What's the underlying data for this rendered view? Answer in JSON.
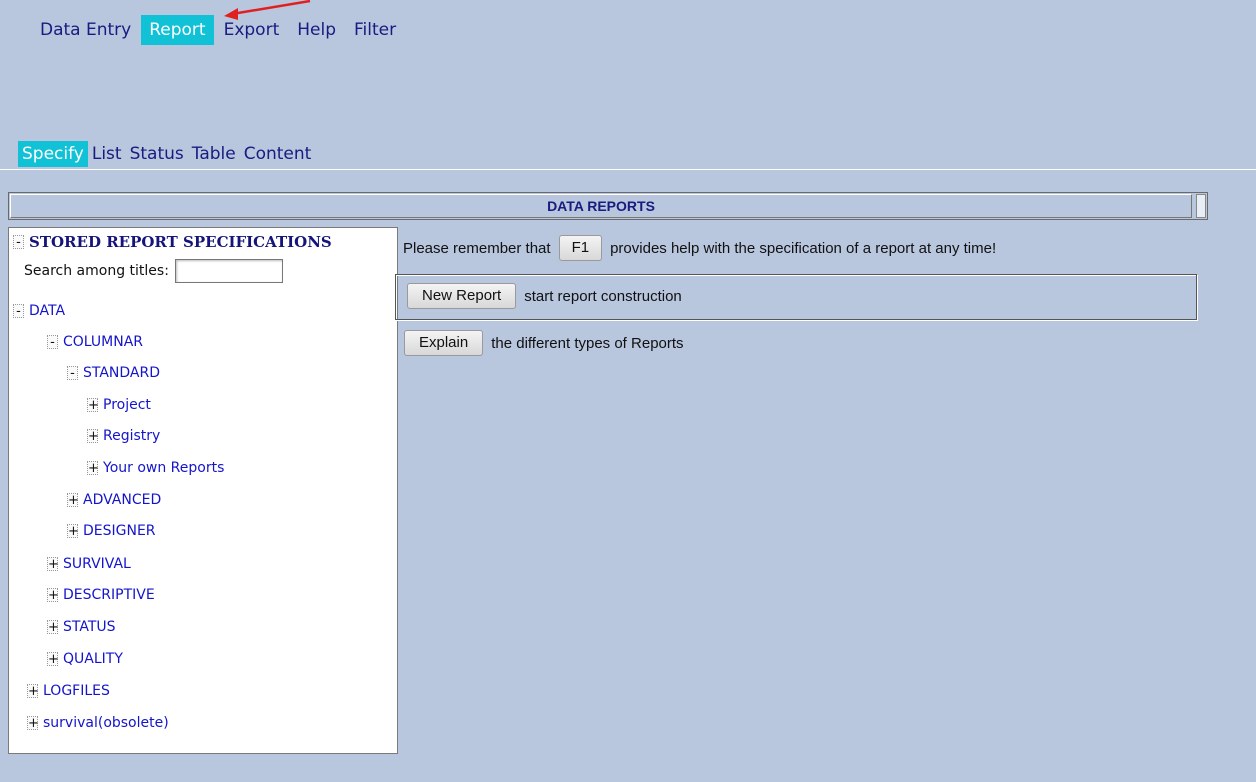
{
  "top_menu": {
    "items": [
      {
        "label": "Data Entry"
      },
      {
        "label": "Report"
      },
      {
        "label": "Export"
      },
      {
        "label": "Help"
      },
      {
        "label": "Filter"
      }
    ],
    "active": "Report"
  },
  "sub_menu": {
    "items": [
      {
        "label": "Specify"
      },
      {
        "label": "List"
      },
      {
        "label": "Status"
      },
      {
        "label": "Table"
      },
      {
        "label": "Content"
      }
    ],
    "active": "Specify"
  },
  "banner": {
    "title": "DATA REPORTS"
  },
  "left_panel": {
    "title": "STORED REPORT SPECIFICATIONS",
    "title_toggle": "-",
    "search_label": "Search among titles:",
    "search_value": "",
    "tree": [
      {
        "label": "DATA",
        "toggle": "-"
      },
      {
        "label": "COLUMNAR",
        "toggle": "-"
      },
      {
        "label": "STANDARD",
        "toggle": "-"
      },
      {
        "label": "Project",
        "toggle": "+"
      },
      {
        "label": "Registry",
        "toggle": "+"
      },
      {
        "label": "Your own Reports",
        "toggle": "+"
      },
      {
        "label": "ADVANCED",
        "toggle": "+"
      },
      {
        "label": "DESIGNER",
        "toggle": "+"
      },
      {
        "label": "SURVIVAL",
        "toggle": "+"
      },
      {
        "label": "DESCRIPTIVE",
        "toggle": "+"
      },
      {
        "label": "STATUS",
        "toggle": "+"
      },
      {
        "label": "QUALITY",
        "toggle": "+"
      },
      {
        "label": "LOGFILES",
        "toggle": "+"
      },
      {
        "label": "survival(obsolete)",
        "toggle": "+"
      }
    ]
  },
  "main": {
    "reminder_before": "Please remember that",
    "f1_button": "F1",
    "reminder_after": "provides help with the specification of a report at any time!",
    "new_report_button": "New Report",
    "new_report_text": "start report construction",
    "explain_button": "Explain",
    "explain_text": "the different types of Reports"
  },
  "colors": {
    "background": "#b8c6de",
    "active_tab": "#11c2d6",
    "link": "#1414cc",
    "annotation_arrow": "#e02020"
  }
}
